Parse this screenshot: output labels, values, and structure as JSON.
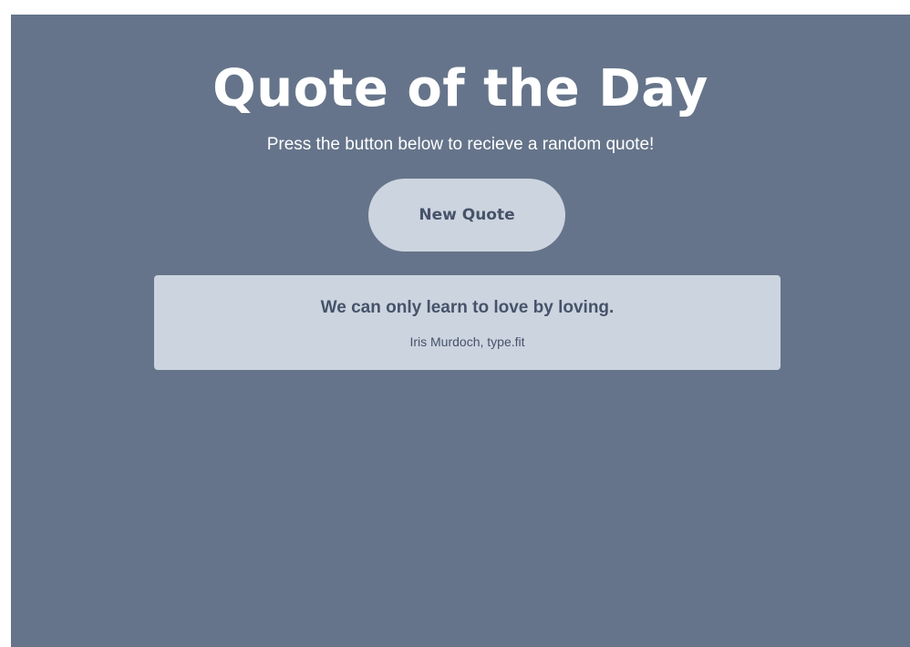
{
  "page": {
    "title": "Quote of the Day",
    "subtitle": "Press the button below to recieve a random quote!"
  },
  "actions": {
    "new_quote_label": "New Quote"
  },
  "quote": {
    "text": "We can only learn to love by loving.",
    "author": "Iris Murdoch, type.fit"
  },
  "colors": {
    "background": "#65748a",
    "card": "#ccd4df",
    "text_dark": "#46536a",
    "text_light": "#ffffff"
  }
}
